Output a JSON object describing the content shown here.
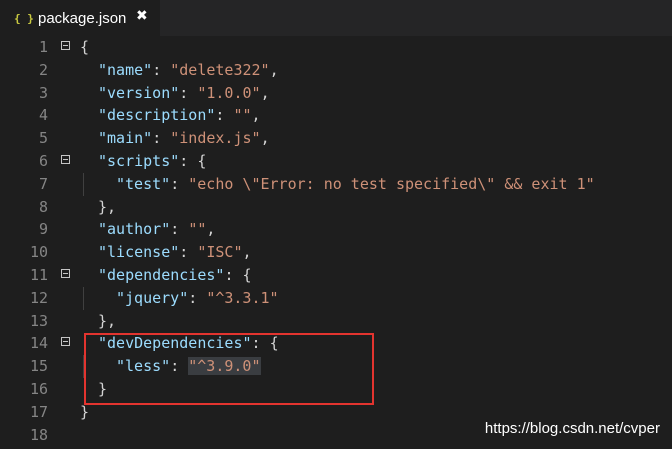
{
  "tab": {
    "icon": "{ }",
    "title": "package.json",
    "close": "✖"
  },
  "lines": [
    {
      "n": "1",
      "fold": true,
      "indent": 0,
      "tokens": [
        {
          "t": "{",
          "c": "pun"
        }
      ]
    },
    {
      "n": "2",
      "fold": false,
      "indent": 1,
      "tokens": [
        {
          "t": "\"name\"",
          "c": "key"
        },
        {
          "t": ": ",
          "c": "pun"
        },
        {
          "t": "\"delete322\"",
          "c": "str"
        },
        {
          "t": ",",
          "c": "pun"
        }
      ]
    },
    {
      "n": "3",
      "fold": false,
      "indent": 1,
      "tokens": [
        {
          "t": "\"version\"",
          "c": "key"
        },
        {
          "t": ": ",
          "c": "pun"
        },
        {
          "t": "\"1.0.0\"",
          "c": "str"
        },
        {
          "t": ",",
          "c": "pun"
        }
      ]
    },
    {
      "n": "4",
      "fold": false,
      "indent": 1,
      "tokens": [
        {
          "t": "\"description\"",
          "c": "key"
        },
        {
          "t": ": ",
          "c": "pun"
        },
        {
          "t": "\"\"",
          "c": "str"
        },
        {
          "t": ",",
          "c": "pun"
        }
      ]
    },
    {
      "n": "5",
      "fold": false,
      "indent": 1,
      "tokens": [
        {
          "t": "\"main\"",
          "c": "key"
        },
        {
          "t": ": ",
          "c": "pun"
        },
        {
          "t": "\"index.js\"",
          "c": "str"
        },
        {
          "t": ",",
          "c": "pun"
        }
      ]
    },
    {
      "n": "6",
      "fold": true,
      "indent": 1,
      "tokens": [
        {
          "t": "\"scripts\"",
          "c": "key"
        },
        {
          "t": ": {",
          "c": "pun"
        }
      ]
    },
    {
      "n": "7",
      "fold": false,
      "indent": 2,
      "tokens": [
        {
          "t": "\"test\"",
          "c": "key"
        },
        {
          "t": ": ",
          "c": "pun"
        },
        {
          "t": "\"echo \\\"Error: no test specified\\\" && exit 1\"",
          "c": "str"
        }
      ]
    },
    {
      "n": "8",
      "fold": false,
      "indent": 1,
      "tokens": [
        {
          "t": "},",
          "c": "pun"
        }
      ]
    },
    {
      "n": "9",
      "fold": false,
      "indent": 1,
      "tokens": [
        {
          "t": "\"author\"",
          "c": "key"
        },
        {
          "t": ": ",
          "c": "pun"
        },
        {
          "t": "\"\"",
          "c": "str"
        },
        {
          "t": ",",
          "c": "pun"
        }
      ]
    },
    {
      "n": "10",
      "fold": false,
      "indent": 1,
      "tokens": [
        {
          "t": "\"license\"",
          "c": "key"
        },
        {
          "t": ": ",
          "c": "pun"
        },
        {
          "t": "\"ISC\"",
          "c": "str"
        },
        {
          "t": ",",
          "c": "pun"
        }
      ]
    },
    {
      "n": "11",
      "fold": true,
      "indent": 1,
      "tokens": [
        {
          "t": "\"dependencies\"",
          "c": "key"
        },
        {
          "t": ": {",
          "c": "pun"
        }
      ]
    },
    {
      "n": "12",
      "fold": false,
      "indent": 2,
      "tokens": [
        {
          "t": "\"jquery\"",
          "c": "key"
        },
        {
          "t": ": ",
          "c": "pun"
        },
        {
          "t": "\"^3.3.1\"",
          "c": "str"
        }
      ]
    },
    {
      "n": "13",
      "fold": false,
      "indent": 1,
      "tokens": [
        {
          "t": "},",
          "c": "pun"
        }
      ]
    },
    {
      "n": "14",
      "fold": true,
      "indent": 1,
      "tokens": [
        {
          "t": "\"devDependencies\"",
          "c": "key"
        },
        {
          "t": ": {",
          "c": "pun"
        }
      ]
    },
    {
      "n": "15",
      "fold": false,
      "indent": 2,
      "tokens": [
        {
          "t": "\"less\"",
          "c": "key"
        },
        {
          "t": ": ",
          "c": "pun"
        },
        {
          "t": "\"^3.9.0\"",
          "c": "str sel"
        }
      ]
    },
    {
      "n": "16",
      "fold": false,
      "indent": 1,
      "tokens": [
        {
          "t": "}",
          "c": "pun"
        }
      ]
    },
    {
      "n": "17",
      "fold": false,
      "indent": 0,
      "tokens": [
        {
          "t": "}",
          "c": "pun"
        }
      ]
    },
    {
      "n": "18",
      "fold": false,
      "indent": 0,
      "tokens": []
    }
  ],
  "watermark": "https://blog.csdn.net/cvper",
  "colors": {
    "background": "#1e1e1e",
    "key": "#9cdcfe",
    "string": "#ce9178",
    "punctuation": "#d4d4d4",
    "line_number": "#858585",
    "annotation_box": "#e3342f",
    "json_icon": "#cbcb41"
  }
}
